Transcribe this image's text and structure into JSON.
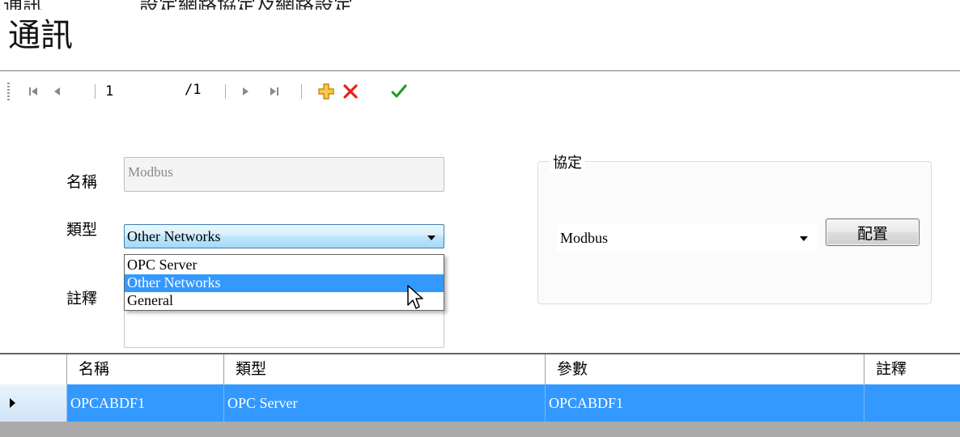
{
  "window": {
    "clipped_caption": "通訊　　　　　設定網路協定及網路設定",
    "title": "通訊"
  },
  "navigator": {
    "first_icon": "first-record-icon",
    "prev_icon": "previous-record-icon",
    "current_page": "1",
    "total_pages": "/1",
    "next_icon": "next-record-icon",
    "last_icon": "last-record-icon",
    "add_icon": "add-icon",
    "delete_icon": "delete-icon",
    "confirm_icon": "confirm-icon",
    "colors": {
      "add": "#f0b21e",
      "delete": "#e0251b",
      "confirm": "#1e9a1e",
      "disabled": "#8a8a8a"
    }
  },
  "form": {
    "name_label": "名稱",
    "name_value": "Modbus",
    "type_label": "類型",
    "type_value": "Other Networks",
    "type_options": [
      "OPC Server",
      "Other Networks",
      "General"
    ],
    "type_highlighted_index": 1,
    "comment_label": "註釋",
    "comment_value": ""
  },
  "protocol_group": {
    "title": "協定",
    "selected": "Modbus",
    "config_button": "配置"
  },
  "grid": {
    "columns": [
      "名稱",
      "類型",
      "參數",
      "註釋"
    ],
    "rows": [
      {
        "name": "OPCABDF1",
        "type": "OPC Server",
        "params": "OPCABDF1",
        "comment": ""
      }
    ],
    "selection_color": "#3399ff"
  }
}
